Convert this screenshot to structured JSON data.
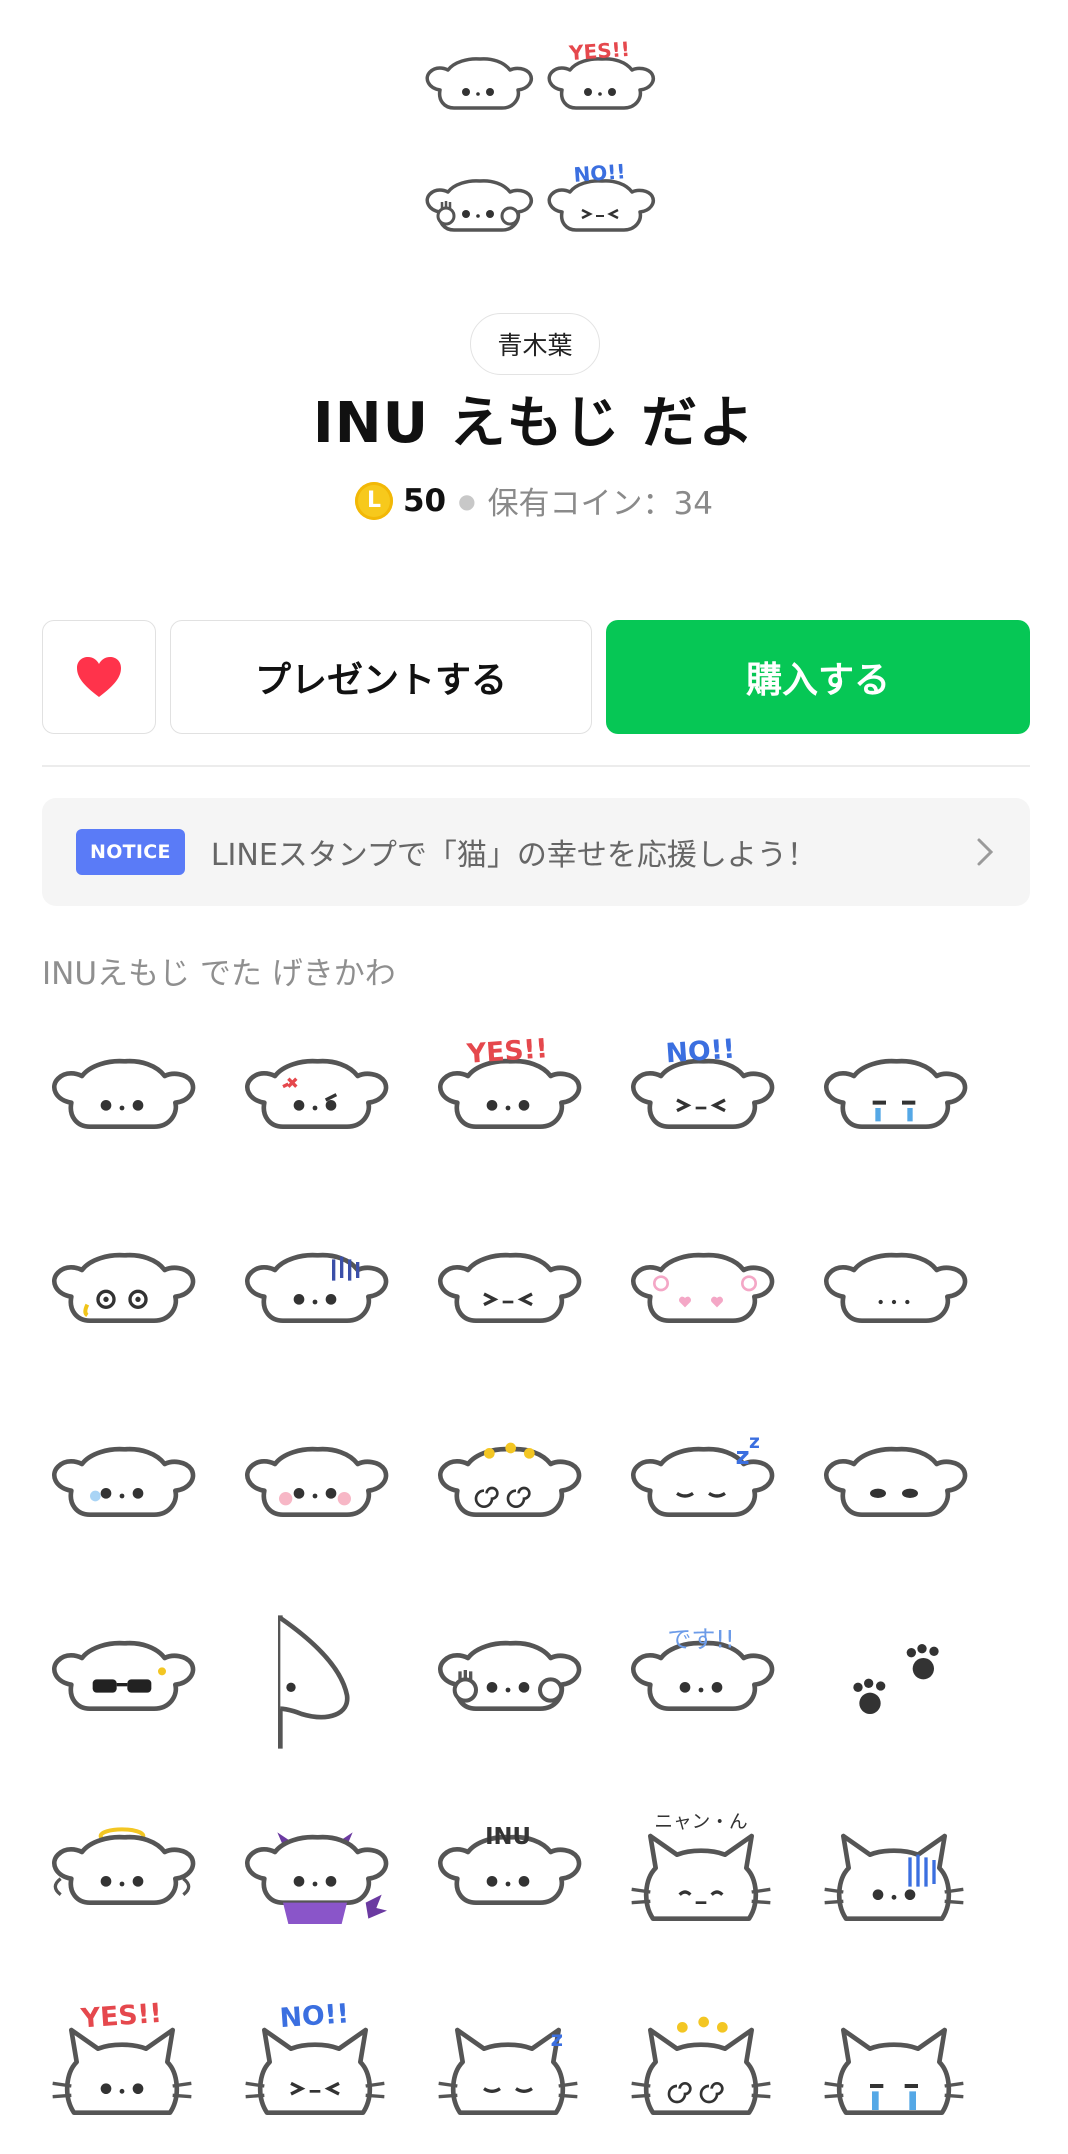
{
  "header": {
    "author": "青木葉",
    "title": "INU えもじ だよ",
    "coin_symbol": "L",
    "price": "50",
    "owned_coins": "保有コイン：34"
  },
  "actions": {
    "present_label": "プレゼントする",
    "buy_label": "購入する",
    "buy_color": "#06c755"
  },
  "notice": {
    "badge": "NOTICE",
    "text": "LINEスタンプで「猫」の幸せを応援しよう！"
  },
  "description": "INUえもじ でた げきかわ",
  "hero_items": [
    "dog-plain",
    "dog-yes",
    "dog-paws",
    "dog-no"
  ],
  "emoji_grid": [
    [
      "dog-plain",
      "dog-angry",
      "dog-yes",
      "dog-no",
      "dog-cry"
    ],
    [
      "dog-sweat",
      "dog-gloom",
      "dog-squint",
      "dog-love",
      "dog-dotface"
    ],
    [
      "dog-blue",
      "dog-blush",
      "dog-dizzy",
      "dog-sleep",
      "dog-sideeye"
    ],
    [
      "dog-sunglasses",
      "dog-flag",
      "dog-paws",
      "dog-desu",
      "paw-prints"
    ],
    [
      "dog-angel",
      "dog-devil",
      "dog-inu",
      "cat-nyan",
      "cat-gloom"
    ],
    [
      "cat-yes",
      "cat-no",
      "cat-sleep",
      "cat-dizzy",
      "cat-cry"
    ]
  ],
  "labels": {
    "yes": "YES!!",
    "no": "NO!!",
    "inu": "INU",
    "nyan": "ニャン・ん",
    "desu": "です!!"
  }
}
